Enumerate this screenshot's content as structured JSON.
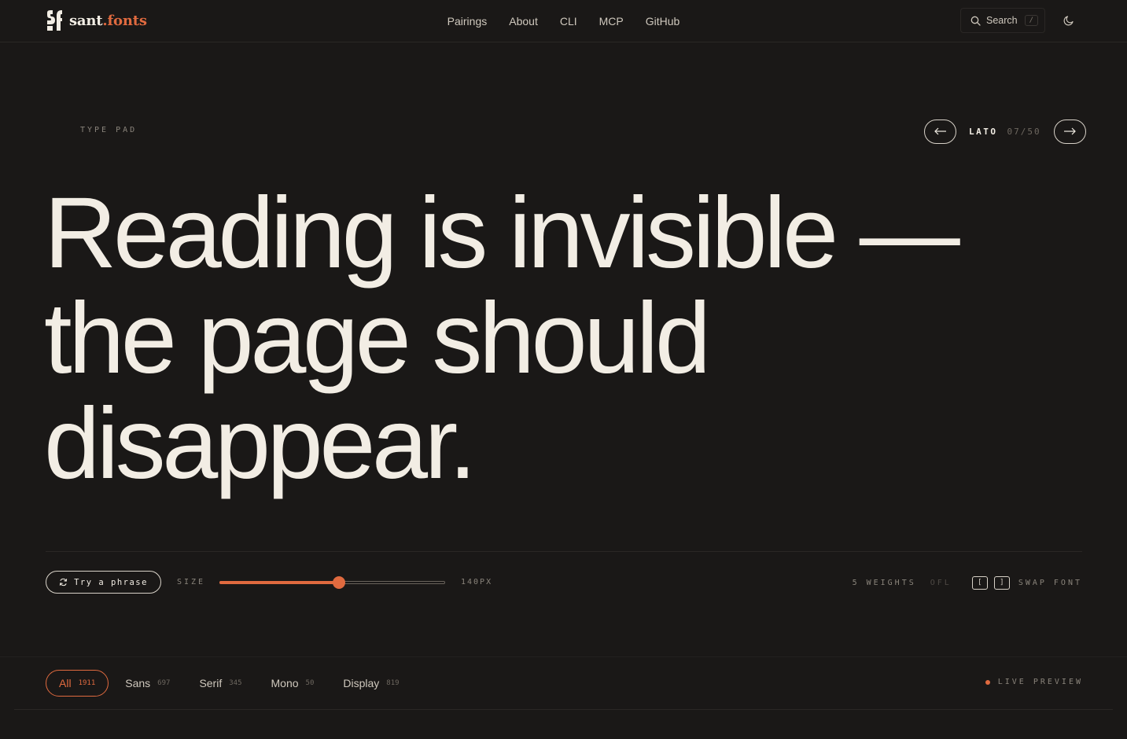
{
  "brand": {
    "name": "sant",
    "suffix": ".fonts",
    "accent": "#e06a3f"
  },
  "nav": {
    "items": [
      "Pairings",
      "About",
      "CLI",
      "MCP",
      "GitHub"
    ]
  },
  "search": {
    "label": "Search",
    "shortcut": "/"
  },
  "typepad": {
    "label": "TYPE PAD",
    "font_name": "LATO",
    "font_index": "07/50"
  },
  "specimen": {
    "lines": [
      "Reading is invisible —",
      "the page should",
      "disappear."
    ]
  },
  "controls": {
    "phrase_button": "Try a phrase",
    "size_label": "SIZE",
    "size_value": "140PX",
    "slider_fraction": 0.53,
    "weights": "5 WEIGHTS",
    "license": "OFL",
    "key_prev": "[",
    "key_next": "]",
    "swap_label": "SWAP FONT"
  },
  "filters": {
    "items": [
      {
        "name": "All",
        "count": "1911",
        "active": true
      },
      {
        "name": "Sans",
        "count": "697",
        "active": false
      },
      {
        "name": "Serif",
        "count": "345",
        "active": false
      },
      {
        "name": "Mono",
        "count": "50",
        "active": false
      },
      {
        "name": "Display",
        "count": "819",
        "active": false
      }
    ],
    "live_label": "LIVE PREVIEW"
  }
}
